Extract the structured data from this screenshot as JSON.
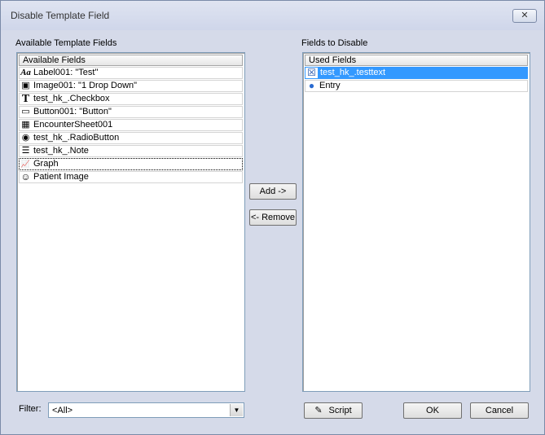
{
  "window": {
    "title": "Disable Template Field",
    "close_glyph": "✕"
  },
  "left_panel": {
    "label": "Available Template Fields",
    "header": "Available Fields",
    "items": [
      {
        "icon": "label-text-icon",
        "glyph": "Aa",
        "label": "Label001: \"Test\""
      },
      {
        "icon": "image-icon",
        "glyph": "▣",
        "label": "Image001: \"1 Drop Down\""
      },
      {
        "icon": "text-field-icon",
        "glyph": "T",
        "label": "test_hk_.Checkbox"
      },
      {
        "icon": "button-icon",
        "glyph": "▭",
        "label": "Button001: \"Button\""
      },
      {
        "icon": "table-grid-icon",
        "glyph": "▦",
        "label": "EncounterSheet001"
      },
      {
        "icon": "radio-button-icon",
        "glyph": "◉",
        "label": "test_hk_.RadioButton"
      },
      {
        "icon": "note-icon",
        "glyph": "☰",
        "label": "test_hk_.Note"
      },
      {
        "icon": "graph-icon",
        "glyph": "📈",
        "label": "Graph"
      },
      {
        "icon": "patient-image-icon",
        "glyph": "☺",
        "label": "Patient Image"
      }
    ]
  },
  "right_panel": {
    "label": "Fields to Disable",
    "header": "Used Fields",
    "items": [
      {
        "icon": "disabled-field-icon",
        "glyph": "☒",
        "label": "test_hk_.testtext"
      },
      {
        "icon": "globe-icon",
        "glyph": "●",
        "label": "Entry"
      }
    ]
  },
  "buttons": {
    "add": "Add ->",
    "remove": "<- Remove",
    "script": "Script",
    "script_glyph": "✎",
    "ok": "OK",
    "cancel": "Cancel"
  },
  "filter": {
    "label": "Filter:",
    "value": "<All>",
    "arrow_glyph": "▼"
  }
}
